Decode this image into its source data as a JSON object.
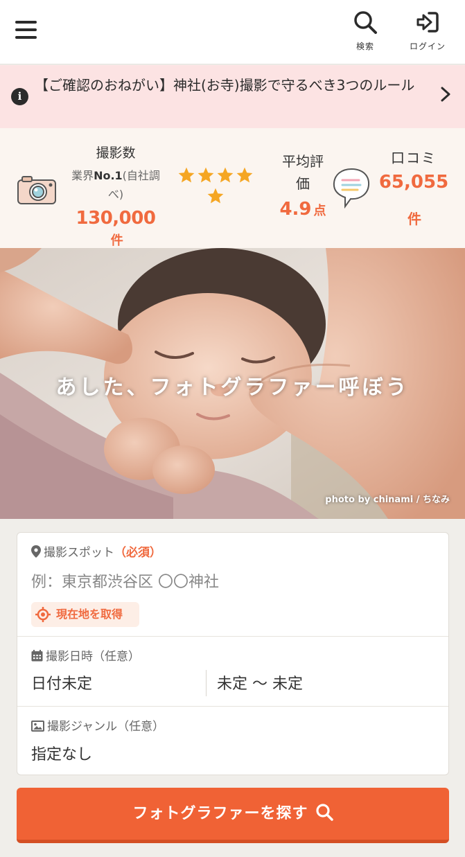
{
  "header": {
    "search_label": "検索",
    "login_label": "ログイン"
  },
  "notice": {
    "text": "【ご確認のおねがい】神社(お寺)撮影で守るべき3つのルール"
  },
  "stats": {
    "shoot_title": "撮影数",
    "shoot_sub_bold": "No.1",
    "shoot_sub_prefix": "業界",
    "shoot_sub_suffix": "(自社調べ)",
    "shoot_count": "130,000",
    "shoot_unit": "件",
    "star_rating": 4.9,
    "avg_title": "平均評価",
    "avg_value": "4.9",
    "avg_unit": "点",
    "reviews_title": "口コミ",
    "reviews_count": "65,055",
    "reviews_unit": "件"
  },
  "hero": {
    "tagline": "あした、フォトグラファー呼ぼう",
    "credit": "photo by chinami / ちなみ"
  },
  "form": {
    "spot_label": "撮影スポット",
    "spot_required": "（必須）",
    "spot_placeholder": "例：東京都渋谷区 〇〇神社",
    "geo_button": "現在地を取得",
    "date_label": "撮影日時（任意）",
    "date_value": "日付未定",
    "time_value": "未定 ～ 未定",
    "genre_label": "撮影ジャンル（任意）",
    "genre_value": "指定なし"
  },
  "cta": {
    "label": "フォトグラファーを探す"
  },
  "colors": {
    "accent": "#f06235",
    "notice_bg": "#fce3e3",
    "stats_bg": "#fbf5f0",
    "star": "#f5a623"
  }
}
